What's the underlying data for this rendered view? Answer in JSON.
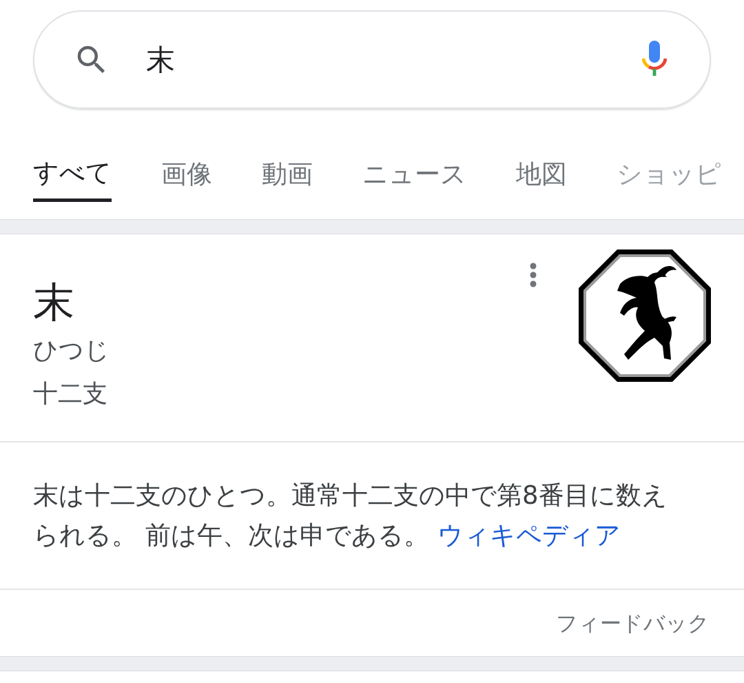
{
  "search": {
    "value": "末"
  },
  "tabs": [
    {
      "label": "すべて",
      "selected": true
    },
    {
      "label": "画像",
      "selected": false
    },
    {
      "label": "動画",
      "selected": false
    },
    {
      "label": "ニュース",
      "selected": false
    },
    {
      "label": "地図",
      "selected": false
    },
    {
      "label": "ショッピ",
      "selected": false
    }
  ],
  "panel": {
    "title": "末",
    "subtitle": "ひつじ",
    "category": "十二支",
    "description": "末は十二支のひとつ。通常十二支の中で第8番目に数えられる。 前は午、次は申である。",
    "source_link": "ウィキペディア"
  },
  "feedback": "フィードバック"
}
